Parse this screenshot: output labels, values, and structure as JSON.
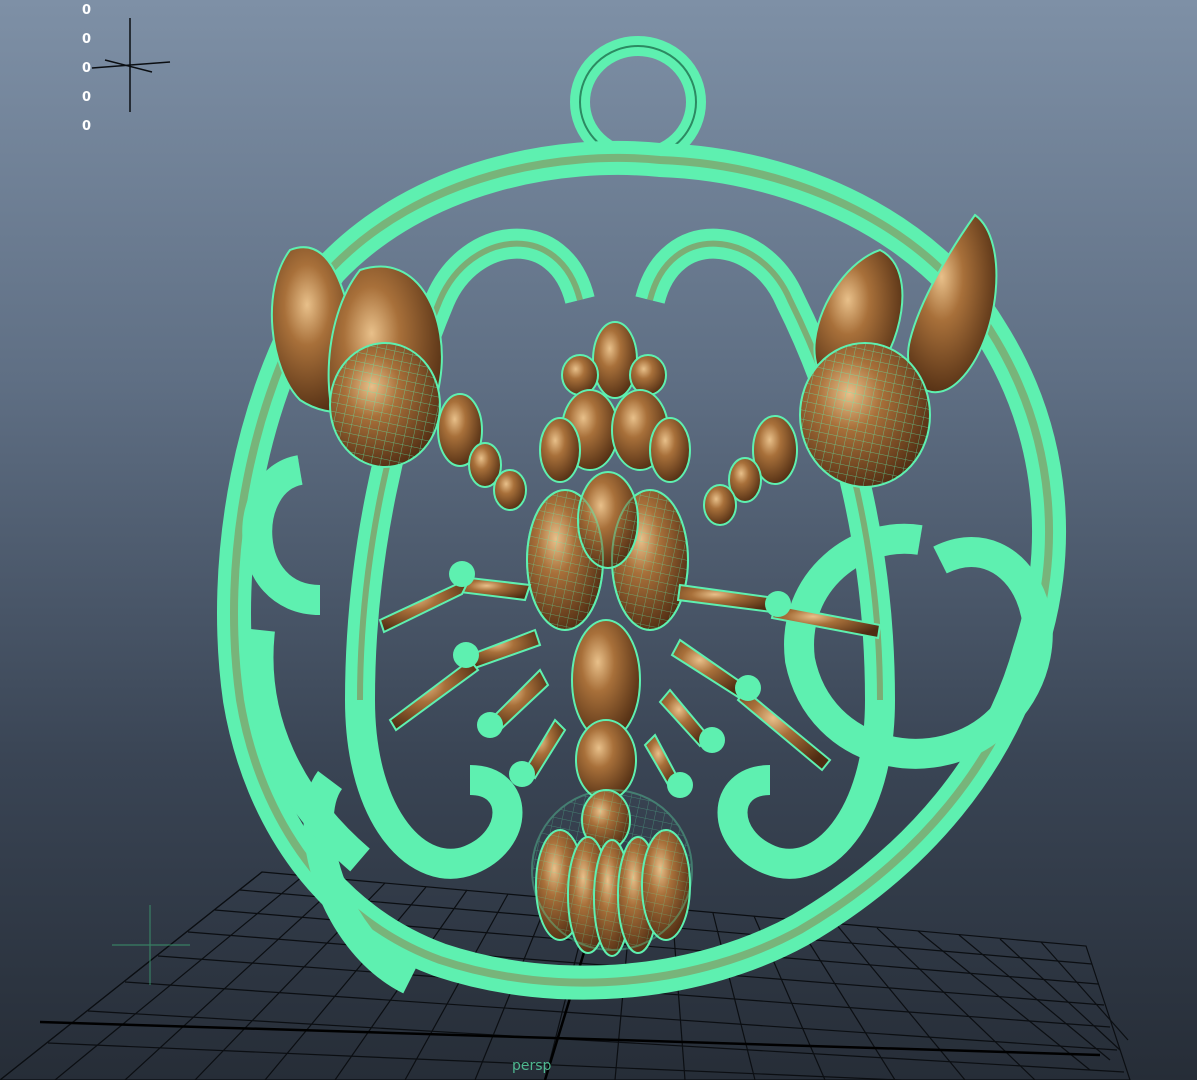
{
  "viewport": {
    "camera_name": "persp",
    "stats": [
      "0",
      "0",
      "0",
      "0",
      "0"
    ]
  },
  "colors": {
    "wireframe": "#5ef0b0",
    "metal": "#7a4a22",
    "metal_highlight": "#e8c08a",
    "grid": "#0b0e12",
    "background_top": "#7e90a6",
    "background_bottom": "#262d37"
  },
  "icons": [
    "axis-gizmo-icon",
    "grid-origin-icon"
  ]
}
